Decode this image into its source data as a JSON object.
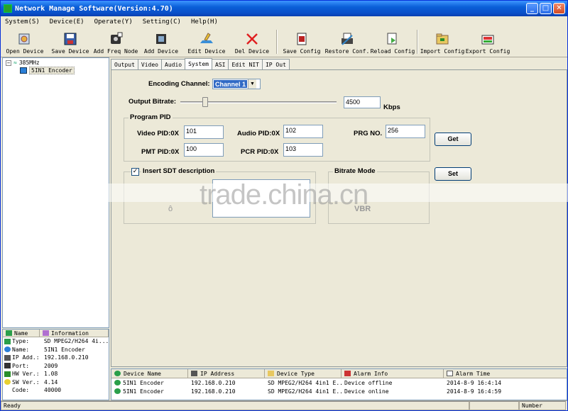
{
  "window": {
    "title": "Network Manage Software(Version:4.70)"
  },
  "menu": [
    "System(S)",
    "Device(E)",
    "Operate(Y)",
    "Setting(C)",
    "Help(H)"
  ],
  "toolbar": [
    {
      "label": "Open Device",
      "icon": "open-device-icon"
    },
    {
      "label": "Save Device",
      "icon": "save-device-icon"
    },
    {
      "label": "Add Freq Node",
      "icon": "add-freq-node-icon"
    },
    {
      "label": "Add Device",
      "icon": "add-device-icon"
    },
    {
      "label": "Edit Device",
      "icon": "edit-device-icon"
    },
    {
      "label": "Del Device",
      "icon": "delete-icon"
    },
    {
      "label": "Save Config",
      "icon": "save-config-icon"
    },
    {
      "label": "Restore Conf.",
      "icon": "restore-config-icon"
    },
    {
      "label": "Reload Config",
      "icon": "reload-config-icon"
    },
    {
      "label": "Import Config",
      "icon": "import-config-icon"
    },
    {
      "label": "Export Config",
      "icon": "export-config-icon"
    }
  ],
  "tree": {
    "root": "385MHz",
    "child": "5IN1  Encoder"
  },
  "info": {
    "headers": [
      "Name",
      "Information"
    ],
    "rows": [
      {
        "k": "Type:",
        "v": "SD MPEG2/H264 4i..."
      },
      {
        "k": "Name:",
        "v": "5IN1  Encoder"
      },
      {
        "k": "IP Add.:",
        "v": "192.168.0.210"
      },
      {
        "k": "Port:",
        "v": "2009"
      },
      {
        "k": "HW Ver.:",
        "v": "1.08"
      },
      {
        "k": "SW Ver.:",
        "v": "4.14"
      },
      {
        "k": "Code:",
        "v": "40000"
      }
    ]
  },
  "tabs": [
    "Output",
    "Video",
    "Audio",
    "System",
    "ASI",
    "Edit NIT",
    "IP Out"
  ],
  "system": {
    "encoding_channel_label": "Encoding Channel:",
    "encoding_channel_value": "Channel 1",
    "output_bitrate_label": "Output Bitrate:",
    "output_bitrate_value": "4500",
    "bitrate_fraction": 0.16,
    "bitrate_unit": "Kbps",
    "program_pid_title": "Program PID",
    "video_pid_label": "Video PID:0X",
    "video_pid": "101",
    "audio_pid_label": "Audio PID:0X",
    "audio_pid": "102",
    "prg_no_label": "PRG NO.",
    "prg_no": "256",
    "pmt_pid_label": "PMT PID:0X",
    "pmt_pid": "100",
    "pcr_pid_label": "PCR PID:0X",
    "pcr_pid": "103",
    "get_label": "Get",
    "set_label": "Set",
    "sdt_label": "Insert SDT description",
    "sdt_checked": "✓",
    "bitrate_mode_title": "Bitrate Mode",
    "vbr_label": "VBR"
  },
  "watermark": "trade.china.cn",
  "log": {
    "headers": [
      "Device Name",
      "IP Address",
      "Device Type",
      "Alarm Info",
      "Alarm Time"
    ],
    "rows": [
      {
        "name": "5IN1  Encoder",
        "ip": "192.168.0.210",
        "type": "SD MPEG2/H264 4in1 E...",
        "alarm": "Device offline",
        "time": "2014-8-9 16:4:14"
      },
      {
        "name": "5IN1  Encoder",
        "ip": "192.168.0.210",
        "type": "SD MPEG2/H264 4in1 E...",
        "alarm": "Device online",
        "time": "2014-8-9 16:4:59"
      }
    ]
  },
  "status": {
    "left": "Ready",
    "right": "Number"
  }
}
